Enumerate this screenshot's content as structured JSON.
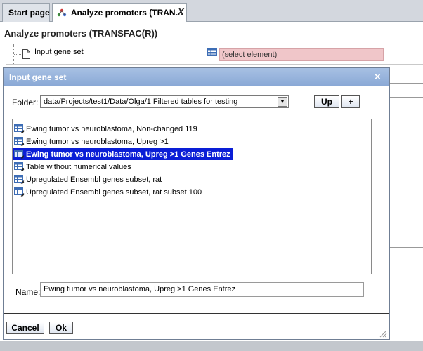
{
  "tabs": [
    {
      "label": "Start page"
    },
    {
      "label": "Analyze promoters (TRAN..."
    }
  ],
  "tab_close_label": "X",
  "page_title": "Analyze promoters (TRANSFAC(R))",
  "property": {
    "label": "Input gene set",
    "value": "(select element)"
  },
  "dialog": {
    "title": "Input gene set",
    "close_label": "×",
    "folder_label": "Folder:",
    "folder_value": "data/Projects/test1/Data/Olga/1 Filtered tables for testing",
    "up_label": "Up",
    "add_label": "+",
    "items": [
      {
        "label": "Ewing tumor vs neuroblastoma, Non-changed 119",
        "icon": "table-icon"
      },
      {
        "label": "Ewing tumor vs neuroblastoma, Upreg >1",
        "icon": "table-icon"
      },
      {
        "label": "Ewing tumor vs neuroblastoma, Upreg >1 Genes Entrez",
        "icon": "table-icon",
        "selected": true
      },
      {
        "label": "Table without numerical values",
        "icon": "table-icon"
      },
      {
        "label": "Upregulated Ensembl genes subset, rat",
        "icon": "table-icon"
      },
      {
        "label": "Upregulated Ensembl genes subset, rat subset 100",
        "icon": "table-icon"
      }
    ],
    "name_label": "Name:",
    "name_value": "Ewing tumor vs neuroblastoma, Upreg >1 Genes Entrez",
    "cancel_label": "Cancel",
    "ok_label": "Ok"
  },
  "colors": {
    "selection": "#0a1ed6",
    "titlebar": "#8aa9d6",
    "required_field": "#f0c6c9"
  }
}
